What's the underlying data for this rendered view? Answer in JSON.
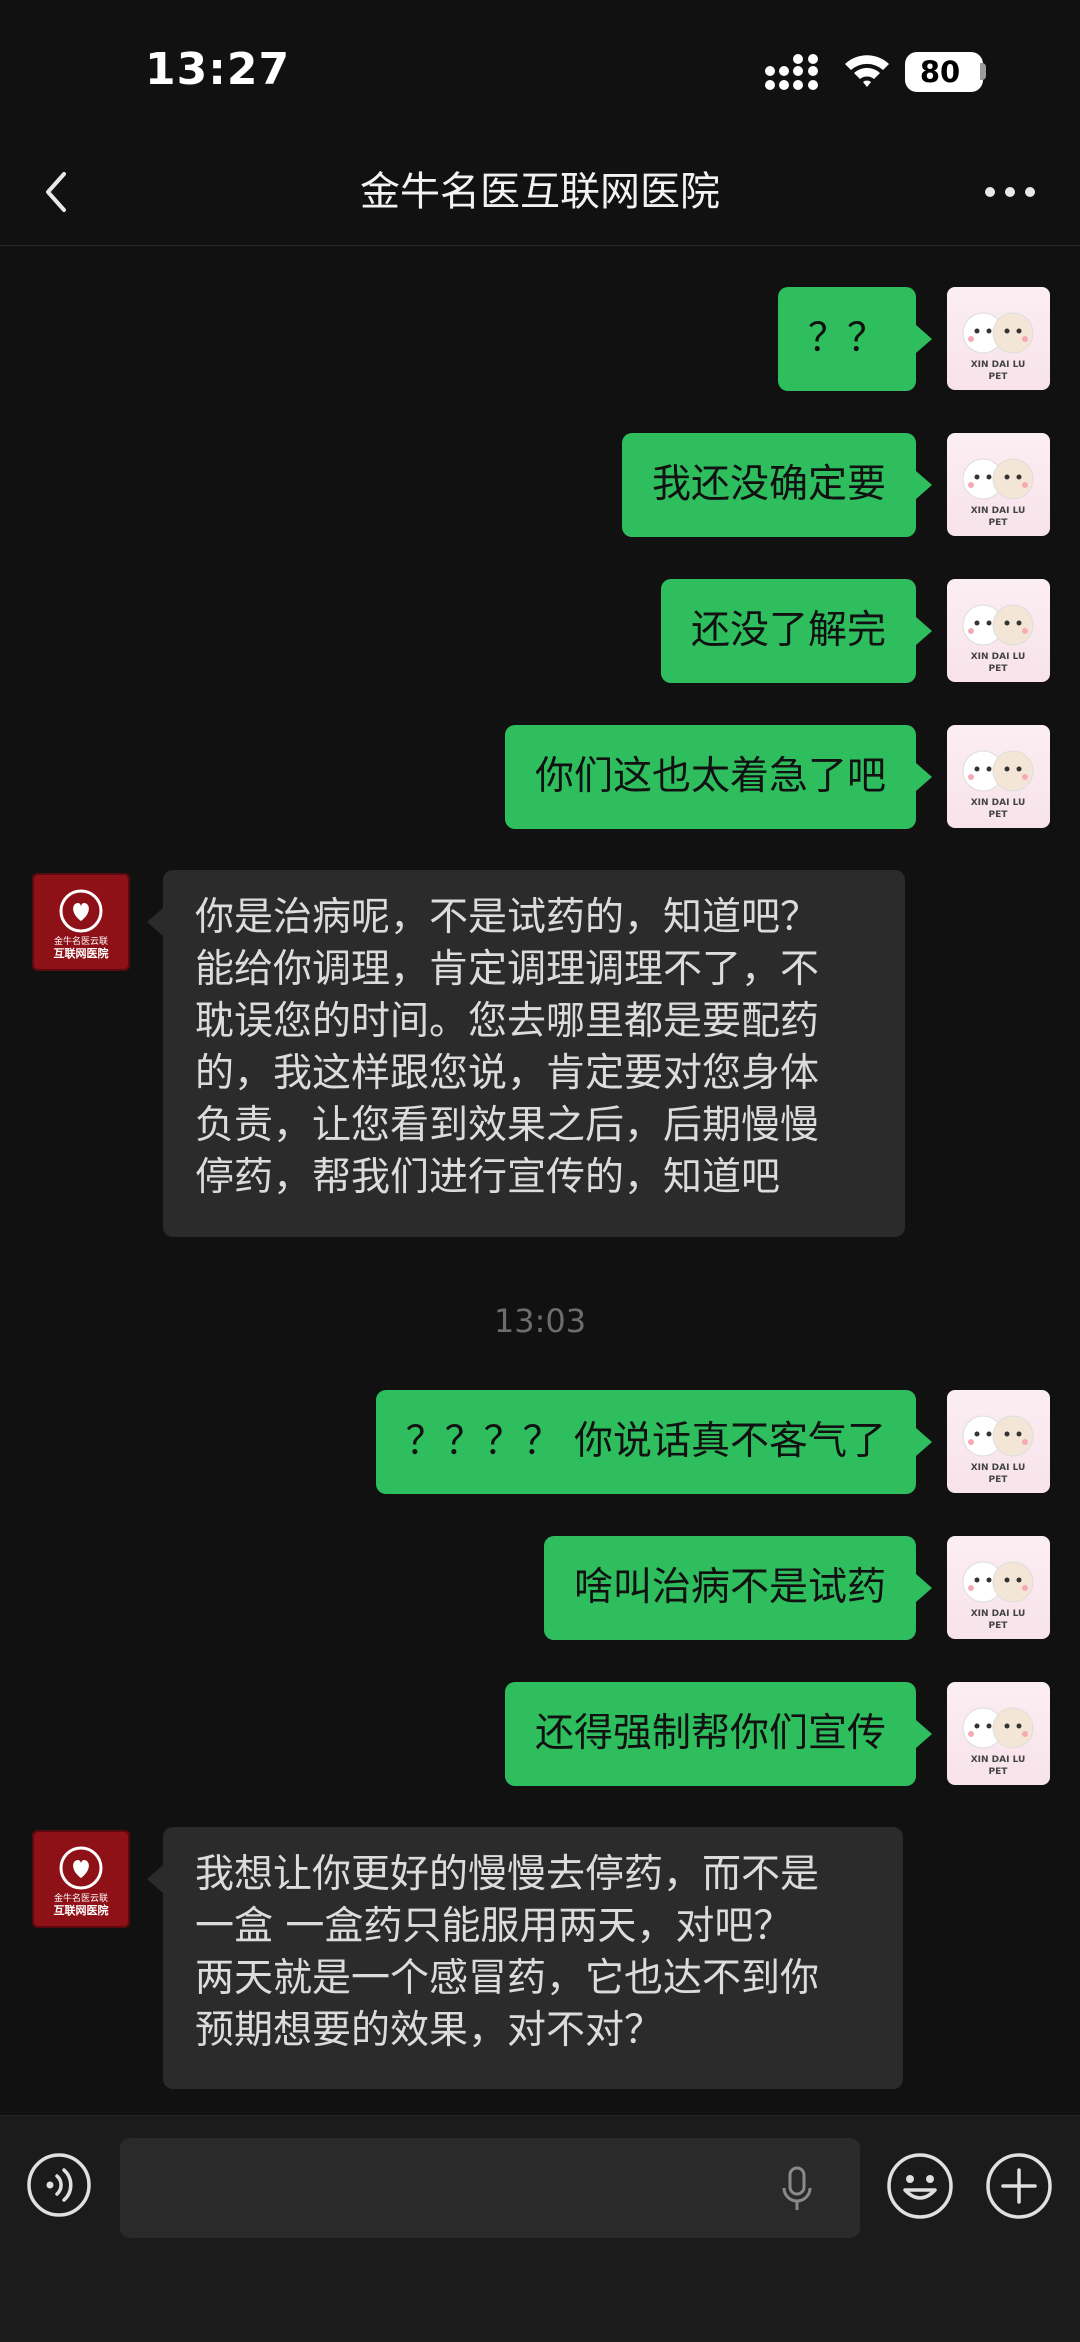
{
  "status_bar": {
    "time": "13:27",
    "battery": "80"
  },
  "header": {
    "title": "金牛名医互联网医院"
  },
  "avatar_me": {
    "line1": "XIN DAI LU",
    "line2": "PET"
  },
  "avatar_doc": {
    "line1": "金牛名医云联",
    "line2": "互联网医院"
  },
  "messages_before": [
    {
      "text": "？？"
    },
    {
      "text": "我还没确定要"
    },
    {
      "text": "还没了解完"
    },
    {
      "text": "你们这也太着急了吧"
    }
  ],
  "doctor_message_1": {
    "lines": [
      "你是治病呢，不是试药的，知道吧？",
      "能给你调理，肯定调理调理不了，不",
      "耽误您的时间。您去哪里都是要配药",
      "的，我这样跟您说，肯定要对您身体",
      "负责，让您看到效果之后，后期慢慢",
      "停药，帮我们进行宣传的，知道吧"
    ]
  },
  "time_separator": "13:03",
  "messages_after": [
    {
      "text": "？？？？ 你说话真不客气了"
    },
    {
      "text": "啥叫治病不是试药"
    },
    {
      "text": "还得强制帮你们宣传"
    }
  ],
  "doctor_message_2": {
    "lines": [
      "我想让你更好的慢慢去停药，而不是",
      "一盒  一盒药只能服用两天，对吧？",
      "两天就是一个感冒药，它也达不到你",
      "预期想要的效果，对不对？"
    ]
  },
  "input_bar": {
    "placeholder": ""
  },
  "colors": {
    "my_bubble": "#2ebe5e",
    "doctor_bubble": "#2b2b2b",
    "background": "#111111"
  },
  "icons": [
    "back-icon",
    "more-icon",
    "voice-icon",
    "mic-icon",
    "emoji-icon",
    "plus-icon",
    "signal-icon",
    "wifi-icon",
    "battery-icon"
  ]
}
